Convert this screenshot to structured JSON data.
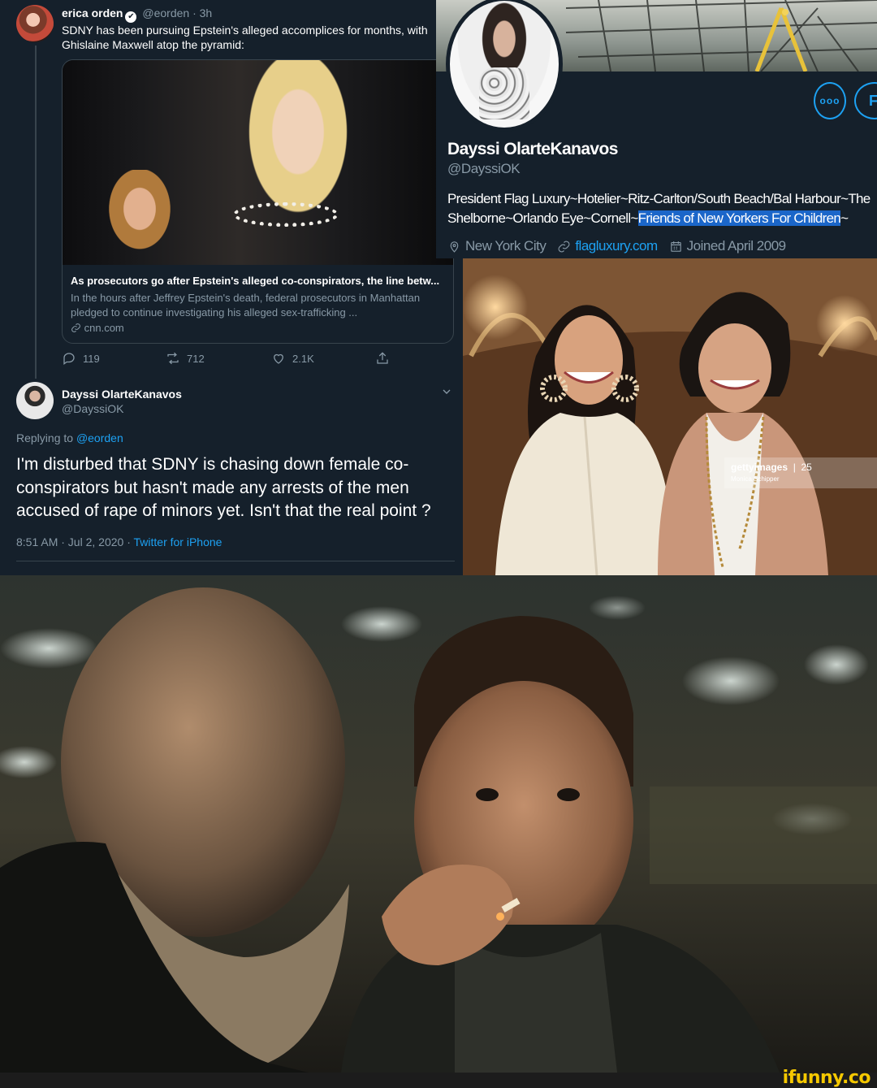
{
  "tweet": {
    "author_name": "erica orden",
    "author_handle": "@eorden",
    "time": "· 3h",
    "verified_icon": "✔",
    "text": "SDNY has been pursuing Epstein's alleged accomplices for months, with Ghislaine Maxwell atop the pyramid:",
    "card": {
      "title": "As prosecutors go after Epstein's alleged co-conspirators, the line betw...",
      "description": "In the hours after Jeffrey Epstein's death, federal prosecutors in Manhattan pledged to continue investigating his alleged sex-trafficking ...",
      "link": "cnn.com"
    },
    "stats": {
      "replies": "119",
      "retweets": "712",
      "likes": "2.1K"
    }
  },
  "reply": {
    "author_name": "Dayssi OlarteKanavos",
    "author_handle": "@DayssiOK",
    "replying_prefix": "Replying to",
    "replying_to": "@eorden",
    "text": "I'm disturbed that SDNY is chasing down female co-conspirators but hasn't made any arrests of the men accused of rape of minors yet.  Isn't that the real point ?",
    "timestamp": "8:51 AM · Jul 2, 2020 ·",
    "source": "Twitter for iPhone"
  },
  "profile": {
    "name": "Dayssi OlarteKanavos",
    "handle": "@DayssiOK",
    "bio_plain": "President Flag Luxury~Hotelier~Ritz-Carlton/South Beach/Bal Harbour~The Shelborne~Orlando Eye~Cornell~",
    "bio_highlight": "Friends of New Yorkers For Children",
    "bio_tail": "~",
    "location": "New York City",
    "website": "flagluxury.com",
    "joined": "Joined April 2009",
    "more_label": "ooo",
    "follow_label": "F"
  },
  "photo": {
    "watermark_brand": "gettyimages",
    "watermark_tag": "25",
    "watermark_credit": "Monica Schipper"
  },
  "footer": {
    "brand": "ifunny.co"
  },
  "colors": {
    "background": "#15202b",
    "muted": "#8899a6",
    "accent": "#1da1f2",
    "highlight": "#1b66c9",
    "brand": "#f5c800"
  },
  "icons": [
    "verified-icon",
    "link-icon",
    "reply-icon",
    "retweet-icon",
    "like-icon",
    "share-icon",
    "chevron-down-icon",
    "location-icon",
    "calendar-icon"
  ]
}
